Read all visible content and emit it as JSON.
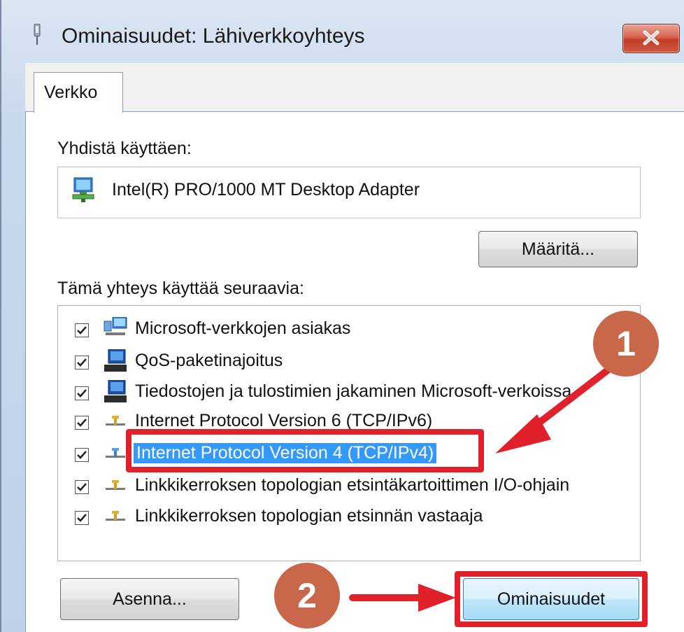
{
  "window": {
    "title": "Ominaisuudet: Lähiverkkoyhteys",
    "tab_label": "Verkko"
  },
  "connect_using": {
    "label": "Yhdistä käyttäen:",
    "adapter_name": "Intel(R) PRO/1000 MT Desktop Adapter",
    "configure_button": "Määritä..."
  },
  "components": {
    "label": "Tämä yhteys käyttää seuraavia:",
    "items": [
      {
        "label": "Microsoft-verkkojen asiakas",
        "checked": true,
        "icon": "network-client-icon"
      },
      {
        "label": "QoS-paketinajoitus",
        "checked": true,
        "icon": "computer-service-icon"
      },
      {
        "label": "Tiedostojen ja tulostimien jakaminen Microsoft-verkoissa",
        "checked": true,
        "icon": "computer-service-icon"
      },
      {
        "label": "Internet Protocol Version 6 (TCP/IPv6)",
        "checked": true,
        "icon": "protocol-icon"
      },
      {
        "label": "Internet Protocol Version 4 (TCP/IPv4)",
        "checked": true,
        "icon": "protocol-icon",
        "selected": true
      },
      {
        "label": "Linkkikerroksen topologian etsintäkartoittimen I/O-ohjain",
        "checked": true,
        "icon": "protocol-icon"
      },
      {
        "label": "Linkkikerroksen topologian etsinnän vastaaja",
        "checked": true,
        "icon": "protocol-icon"
      }
    ]
  },
  "buttons": {
    "install": "Asenna...",
    "properties": "Ominaisuudet"
  },
  "annotations": {
    "step1": "1",
    "step2": "2",
    "highlight_color": "#e0202a",
    "badge_color": "#c9674a"
  }
}
